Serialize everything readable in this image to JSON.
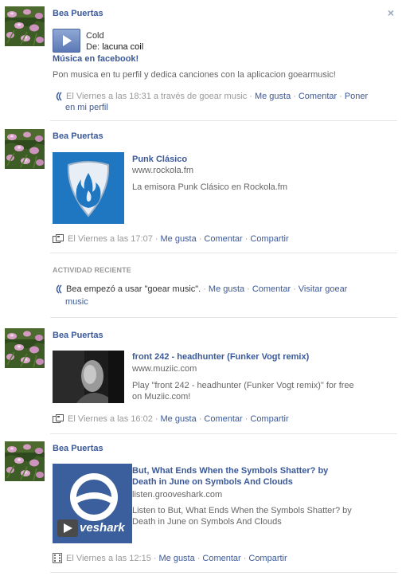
{
  "story1": {
    "author": "Bea Puertas",
    "close_glyph": "×",
    "track_title": "Cold",
    "from_label": "De:",
    "artist": "lacuna coil",
    "app_heading": "Música en facebook!",
    "message": "Pon musica en tu perfil y dedica canciones con la aplicacion goearmusic!",
    "timestamp": "El Viernes a las 18:31 a través de goear music",
    "like": "Me gusta",
    "comment": "Comentar",
    "extra_action_line1": "Poner",
    "extra_action_line2": "en mi perfil"
  },
  "story2": {
    "author": "Bea Puertas",
    "title": "Punk Clásico",
    "url": "www.rockola.fm",
    "description": "La emisora Punk Clásico en Rockola.fm",
    "timestamp": "El Viernes a las 17:07",
    "like": "Me gusta",
    "comment": "Comentar",
    "share": "Compartir"
  },
  "recent": {
    "label": "ACTIVIDAD RECIENTE",
    "text": "Bea empezó a usar \"goear music\".",
    "like": "Me gusta",
    "comment": "Comentar",
    "visit_line1": "Visitar goear",
    "visit_line2": "music"
  },
  "story3": {
    "author": "Bea Puertas",
    "title": "front 242 - headhunter (Funker Vogt remix)",
    "url": "www.muziic.com",
    "description_line1": "Play \"front 242 - headhunter (Funker Vogt remix)\" for free",
    "description_line2": "on Muziic.com!",
    "timestamp": "El Viernes a las 16:02",
    "like": "Me gusta",
    "comment": "Comentar",
    "share": "Compartir"
  },
  "story4": {
    "author": "Bea Puertas",
    "title_line1": "But, What Ends When the Symbols Shatter? by",
    "title_line2": "Death in June on Symbols And Clouds",
    "url": "listen.grooveshark.com",
    "description_line1": "Listen to But, What Ends When the Symbols Shatter? by",
    "description_line2": "Death in June on Symbols And Clouds",
    "thumb_brand": "veshark",
    "timestamp": "El Viernes a las 12:15",
    "like": "Me gusta",
    "comment": "Comentar",
    "share": "Compartir"
  },
  "colors": {
    "link": "#3b5998",
    "meta": "#999999",
    "separator": "#e5e5e5",
    "rockola_bg": "#1f77c2",
    "grooveshark_bg": "#3a5f9c"
  }
}
